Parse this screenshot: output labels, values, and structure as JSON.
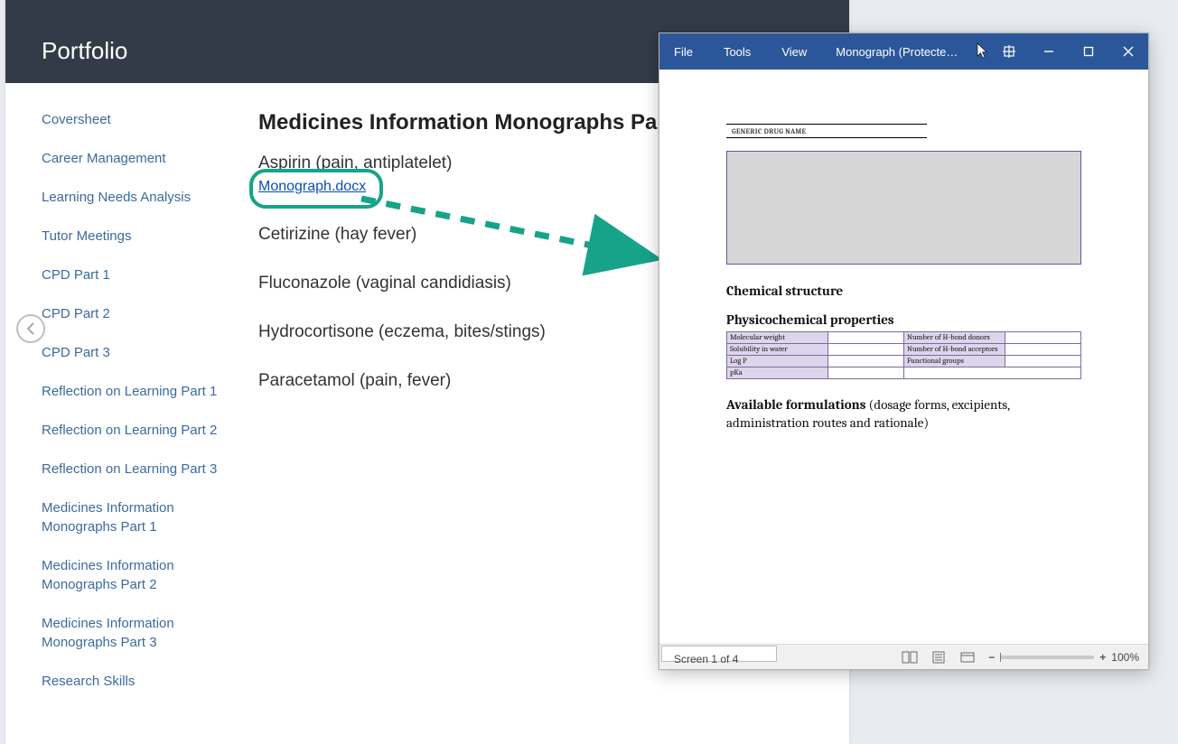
{
  "header": {
    "title": "Portfolio"
  },
  "sidebar": {
    "items": [
      "Coversheet",
      "Career Management",
      "Learning Needs Analysis",
      "Tutor Meetings",
      "CPD Part 1",
      "CPD Part 2",
      "CPD Part 3",
      "Reflection on Learning Part 1",
      "Reflection on Learning Part 2",
      "Reflection on Learning Part 3",
      "Medicines Information Monographs Part 1",
      "Medicines Information Monographs Part 2",
      "Medicines Information Monographs Part 3",
      "Research Skills"
    ]
  },
  "main": {
    "heading": "Medicines Information Monographs Pa",
    "medicines": [
      {
        "title": "Aspirin (pain, antiplatelet)",
        "link": "Monograph.docx"
      },
      {
        "title": "Cetirizine (hay fever)"
      },
      {
        "title": "Fluconazole (vaginal candidiasis)"
      },
      {
        "title": "Hydrocortisone (eczema, bites/stings)"
      },
      {
        "title": "Paracetamol (pain, fever)"
      }
    ]
  },
  "word": {
    "menu": {
      "file": "File",
      "tools": "Tools",
      "view": "View"
    },
    "doc_title": "Monograph (Protected…",
    "doc": {
      "generic_name_label": "GENERIC DRUG NAME",
      "chemical_structure": "Chemical structure",
      "phys_prop": "Physicochemical properties",
      "table": {
        "r1c1": "Molecular weight",
        "r1c3": "Number of H-bond donors",
        "r2c1": "Solubility in water",
        "r2c3": "Number of H-bond acceptors",
        "r3c1": "Log P",
        "r3c3": "Functional groups",
        "r4c1": "pKa"
      },
      "avail_bold": "Available formulations",
      "avail_rest": " (dosage forms, excipients, administration routes and rationale)"
    },
    "status": {
      "screen": "Screen 1 of 4",
      "zoom_pct": "100%"
    }
  }
}
